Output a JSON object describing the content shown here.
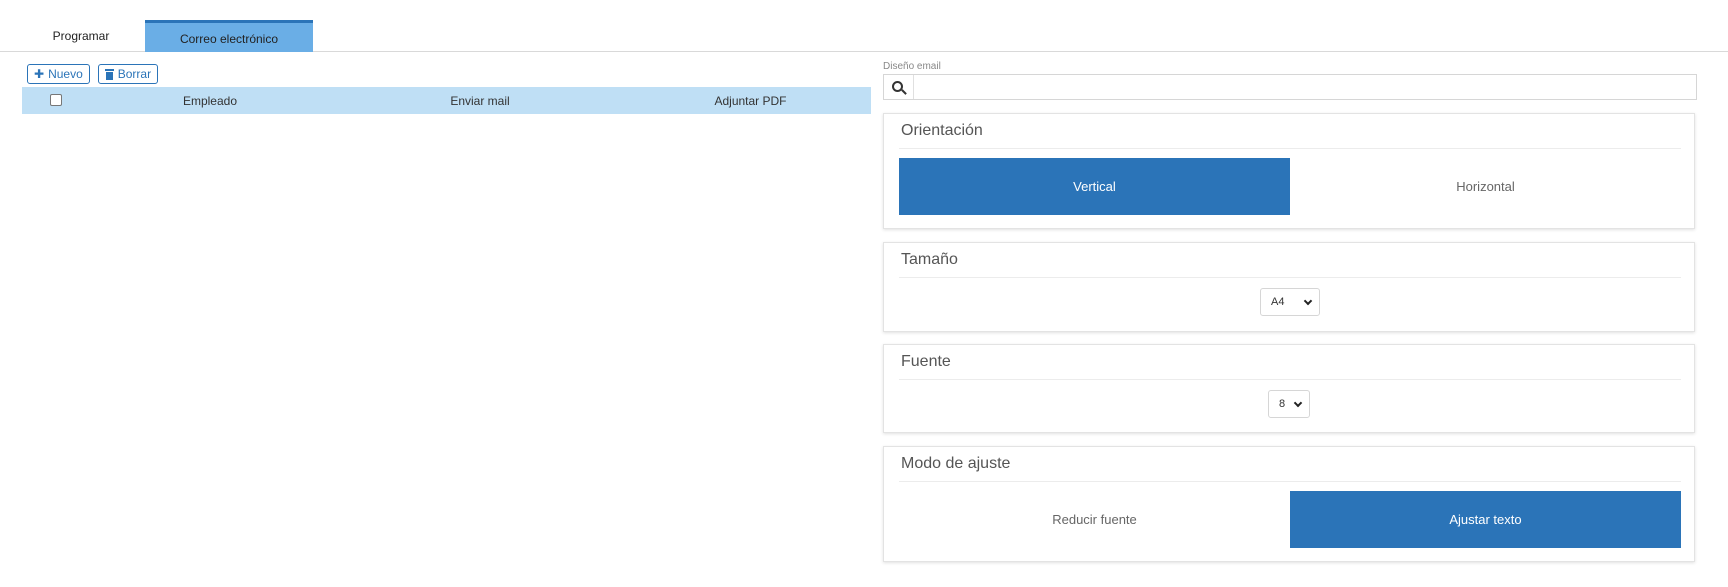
{
  "tabs": [
    {
      "label": "Programar",
      "active": false
    },
    {
      "label": "Correo electrónico",
      "active": true
    }
  ],
  "toolbar": {
    "new_label": "Nuevo",
    "delete_label": "Borrar"
  },
  "grid": {
    "columns": [
      "Empleado",
      "Enviar mail",
      "Adjuntar PDF"
    ],
    "rows": []
  },
  "design": {
    "label": "Diseño email",
    "placeholder": ""
  },
  "orientation": {
    "title": "Orientación",
    "options": [
      "Vertical",
      "Horizontal"
    ],
    "selected": "Vertical"
  },
  "size": {
    "title": "Tamaño",
    "value": "A4"
  },
  "font": {
    "title": "Fuente",
    "value": "8"
  },
  "fit_mode": {
    "title": "Modo de ajuste",
    "options": [
      "Reducir fuente",
      "Ajustar texto"
    ],
    "selected": "Ajustar texto"
  },
  "colors": {
    "accent": "#2b74b8",
    "tab_active": "#6aaee6",
    "grid_header": "#bfdff5"
  }
}
